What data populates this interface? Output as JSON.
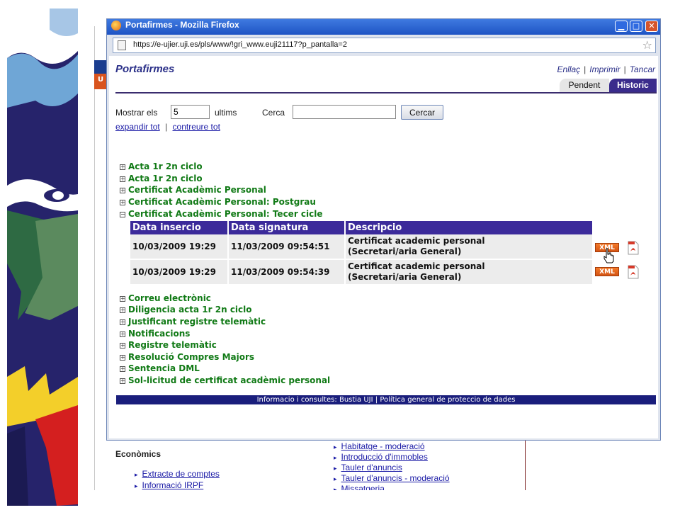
{
  "window": {
    "title": "Portafirmes - Mozilla Firefox",
    "url": "https://e-ujier.uji.es/pls/www/!gri_www.euji21117?p_pantalla=2"
  },
  "header": {
    "app_title": "Portafirmes",
    "links": [
      "Enllaç",
      "Imprimir",
      "Tancar"
    ],
    "separator": "|"
  },
  "tabs": [
    "Pendent",
    "Historic"
  ],
  "filter": {
    "show_label": "Mostrar els",
    "count_value": "5",
    "last_label": "ultims",
    "search_label": "Cerca",
    "search_value": "",
    "search_button": "Cercar",
    "expand_all": "expandir tot",
    "collapse_all": "contreure tot",
    "separator": "|"
  },
  "tree_before": [
    {
      "label": "Acta 1r 2n ciclo",
      "toggle": "+"
    },
    {
      "label": "Acta 1r 2n ciclo",
      "toggle": "+"
    },
    {
      "label": "Certificat Acadèmic Personal",
      "toggle": "+"
    },
    {
      "label": "Certificat Acadèmic Personal: Postgrau",
      "toggle": "+"
    },
    {
      "label": "Certificat Acadèmic Personal: Tecer cicle",
      "toggle": "−"
    }
  ],
  "table": {
    "headers": [
      "Data insercio",
      "Data signatura",
      "Descripcio"
    ],
    "rows": [
      {
        "inserted": "10/03/2009 19:29",
        "signed": "11/03/2009 09:54:51",
        "desc_line1": "Certificat academic personal",
        "desc_line2": "(Secretari/aria General)",
        "xml_label": "XML"
      },
      {
        "inserted": "10/03/2009 19:29",
        "signed": "11/03/2009 09:54:39",
        "desc_line1": "Certificat academic personal",
        "desc_line2": "(Secretari/aria General)",
        "xml_label": "XML"
      }
    ]
  },
  "tree_after": [
    {
      "label": "Correu electrònic",
      "toggle": "+"
    },
    {
      "label": "Diligencia acta 1r 2n ciclo",
      "toggle": "+"
    },
    {
      "label": "Justificant registre telemàtic",
      "toggle": "+"
    },
    {
      "label": "Notificacions",
      "toggle": "+"
    },
    {
      "label": "Registre telemàtic",
      "toggle": "+"
    },
    {
      "label": "Resolució Compres Majors",
      "toggle": "+"
    },
    {
      "label": "Sentencia DML",
      "toggle": "+"
    },
    {
      "label": "Sol-licitud de certificat acadèmic personal",
      "toggle": "+"
    }
  ],
  "footer": {
    "info": "Informacio i consultes:",
    "bustia": "Bustia UJI",
    "separator": "|",
    "policy": "Política general de proteccio de dades"
  },
  "background_page": {
    "strip_label": "U",
    "section_title": "Econòmics",
    "left_links": [
      "Extracte de comptes",
      "Informació IRPF"
    ],
    "right_links": [
      "Habitatge - moderació",
      "Introducció d'immobles",
      "Tauler d'anuncis",
      "Tauler d'anuncis - moderació",
      "Missatgeria"
    ]
  },
  "colors": {
    "header_purple": "#3b2a9a",
    "tree_green": "#117a16",
    "footer_navy": "#1a1e7c",
    "xml_orange": "#e8661f"
  }
}
